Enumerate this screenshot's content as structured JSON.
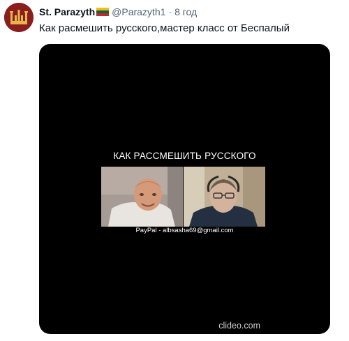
{
  "tweet": {
    "display_name": "St. Parazyth",
    "flag_icon": "lithuania-flag",
    "handle": "@Parazyth1",
    "separator": "·",
    "time": "8 год",
    "text": "Как расмешить русского,мастер класс от Беспалый"
  },
  "video": {
    "title": "КАК РАССМЕШИТЬ РУССКОГО",
    "caption": "PayPal - albsasha69@gmail.com",
    "watermark": "clideo.com"
  },
  "colors": {
    "avatar_bg": "#8a1e1e",
    "media_bg": "#000000",
    "handle_gray": "#536471",
    "flag_yellow": "#fdb913",
    "flag_green": "#006a44",
    "flag_red": "#c1272d"
  }
}
